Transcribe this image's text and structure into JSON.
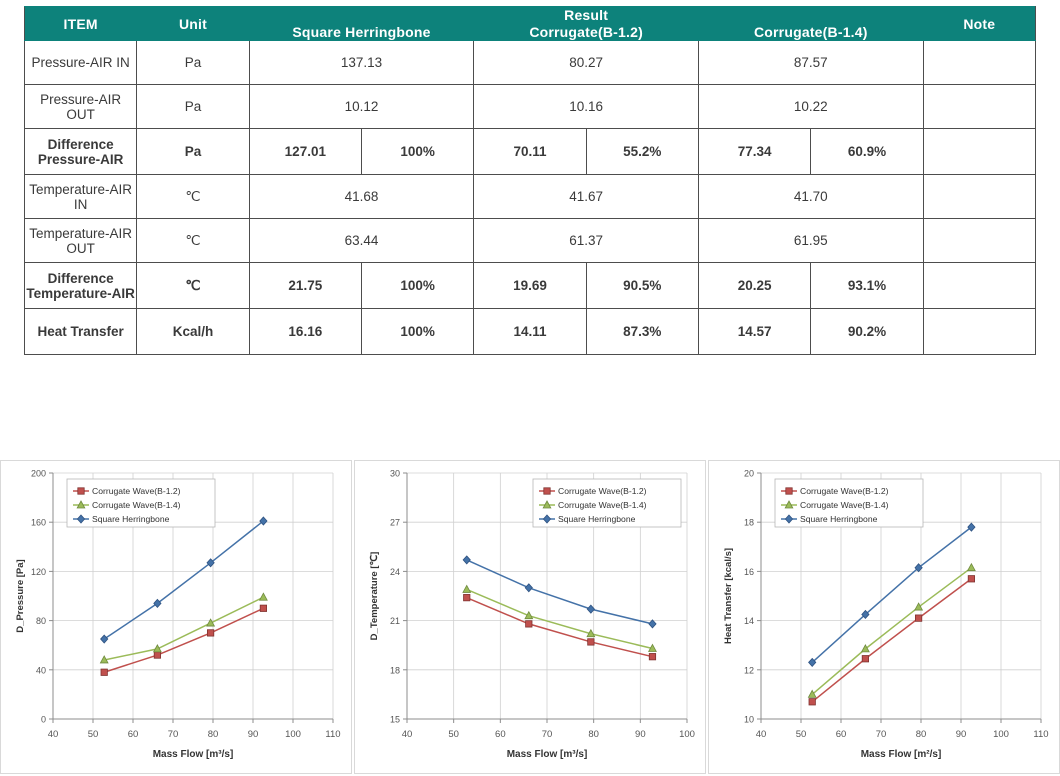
{
  "table": {
    "headers": {
      "item": "ITEM",
      "unit": "Unit",
      "result": "Result",
      "note": "Note",
      "cols": [
        "Square Herringbone",
        "Corrugate(B-1.2)",
        "Corrugate(B-1.4)"
      ]
    },
    "rows": [
      {
        "item": "Pressure-AIR IN",
        "unit": "Pa",
        "style": "normal",
        "split": false,
        "values": [
          "137.13",
          "80.27",
          "87.57"
        ],
        "note": ""
      },
      {
        "item": "Pressure-AIR OUT",
        "unit": "Pa",
        "style": "normal",
        "split": false,
        "values": [
          "10.12",
          "10.16",
          "10.22"
        ],
        "note": ""
      },
      {
        "item": "Difference Pressure-AIR",
        "unit": "Pa",
        "style": "blue",
        "split": true,
        "values": [
          "127.01",
          "70.11",
          "77.34"
        ],
        "percents": [
          "100%",
          "55.2%",
          "60.9%"
        ],
        "note": ""
      },
      {
        "item": "Temperature-AIR IN",
        "unit": "℃",
        "style": "normal",
        "split": false,
        "values": [
          "41.68",
          "41.67",
          "41.70"
        ],
        "note": ""
      },
      {
        "item": "Temperature-AIR OUT",
        "unit": "℃",
        "style": "normal",
        "split": false,
        "values": [
          "63.44",
          "61.37",
          "61.95"
        ],
        "note": ""
      },
      {
        "item": "Difference Temperature-AIR",
        "unit": "℃",
        "style": "dark",
        "split": true,
        "values": [
          "21.75",
          "19.69",
          "20.25"
        ],
        "percents": [
          "100%",
          "90.5%",
          "93.1%"
        ],
        "note": ""
      },
      {
        "item": "Heat Transfer",
        "unit": "Kcal/h",
        "style": "red",
        "split": true,
        "values": [
          "16.16",
          "14.11",
          "14.57"
        ],
        "percents": [
          "100%",
          "87.3%",
          "90.2%"
        ],
        "note": ""
      }
    ],
    "colors": {
      "header_bg": "#0d827b",
      "blue_text": "#1f22e8",
      "red_text": "#fb3b3b",
      "dark_text": "#232323"
    }
  },
  "chart_data": [
    {
      "type": "line",
      "title": "",
      "xlabel": "Mass Flow [m³/s]",
      "ylabel": "D_Pressure [Pa]",
      "xlim": [
        40,
        110
      ],
      "ylim": [
        0,
        200
      ],
      "xticks": [
        40,
        50,
        60,
        70,
        80,
        90,
        100,
        110
      ],
      "yticks": [
        0,
        40,
        80,
        120,
        160,
        200
      ],
      "grid": true,
      "legend_position": "top-left",
      "x": [
        52.8,
        66.1,
        79.4,
        92.6
      ],
      "series": [
        {
          "name": "Corrugate Wave(B-1.2)",
          "color": "#c0504d",
          "marker": "square",
          "values": [
            38,
            52,
            70,
            90
          ]
        },
        {
          "name": "Corrugate Wave(B-1.4)",
          "color": "#9bbb59",
          "marker": "triangle",
          "values": [
            48,
            57,
            78,
            99
          ]
        },
        {
          "name": "Square Herringbone",
          "color": "#4472a8",
          "marker": "diamond",
          "values": [
            65,
            94,
            127,
            161
          ]
        }
      ]
    },
    {
      "type": "line",
      "title": "",
      "xlabel": "Mass Flow [m³/s]",
      "ylabel": "D_Temperature [℃]",
      "xlim": [
        40,
        100
      ],
      "ylim": [
        15,
        30
      ],
      "xticks": [
        40,
        50,
        60,
        70,
        80,
        90,
        100
      ],
      "yticks": [
        15,
        18,
        21,
        24,
        27,
        30
      ],
      "grid": true,
      "legend_position": "top-right",
      "x": [
        52.8,
        66.1,
        79.4,
        92.6
      ],
      "series": [
        {
          "name": "Corrugate Wave(B-1.2)",
          "color": "#c0504d",
          "marker": "square",
          "values": [
            22.4,
            20.8,
            19.7,
            18.8
          ]
        },
        {
          "name": "Corrugate Wave(B-1.4)",
          "color": "#9bbb59",
          "marker": "triangle",
          "values": [
            22.9,
            21.3,
            20.2,
            19.3
          ]
        },
        {
          "name": "Square Herringbone",
          "color": "#4472a8",
          "marker": "diamond",
          "values": [
            24.7,
            23.0,
            21.7,
            20.8
          ]
        }
      ]
    },
    {
      "type": "line",
      "title": "",
      "xlabel": "Mass Flow [m²/s]",
      "ylabel": "Heat Transfer [kcal/s]",
      "xlim": [
        40,
        110
      ],
      "ylim": [
        10,
        20
      ],
      "xticks": [
        40,
        50,
        60,
        70,
        80,
        90,
        100,
        110
      ],
      "yticks": [
        10,
        12,
        14,
        16,
        18,
        20
      ],
      "grid": true,
      "legend_position": "top-left",
      "x": [
        52.8,
        66.1,
        79.4,
        92.6
      ],
      "series": [
        {
          "name": "Corrugate Wave(B-1.2)",
          "color": "#c0504d",
          "marker": "square",
          "values": [
            10.7,
            12.45,
            14.1,
            15.7
          ]
        },
        {
          "name": "Corrugate Wave(B-1.4)",
          "color": "#9bbb59",
          "marker": "triangle",
          "values": [
            11.0,
            12.85,
            14.55,
            16.15
          ]
        },
        {
          "name": "Square Herringbone",
          "color": "#4472a8",
          "marker": "diamond",
          "values": [
            12.3,
            14.25,
            16.15,
            17.8
          ]
        }
      ]
    }
  ]
}
